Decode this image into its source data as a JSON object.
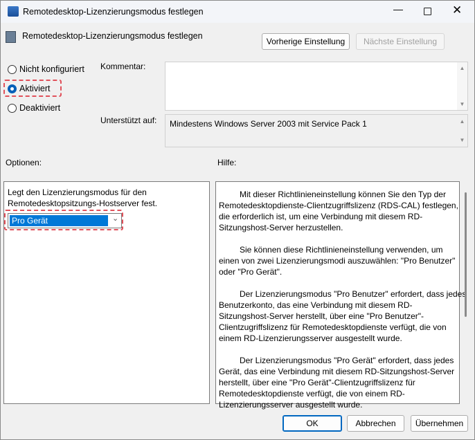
{
  "window": {
    "title": "Remotedesktop-Lizenzierungsmodus festlegen"
  },
  "header": {
    "title": "Remotedesktop-Lizenzierungsmodus festlegen",
    "prev_label": "Vorherige Einstellung",
    "next_label": "Nächste Einstellung"
  },
  "state": {
    "options": [
      "Nicht konfiguriert",
      "Aktiviert",
      "Deaktiviert"
    ],
    "selected": "Aktiviert"
  },
  "comment": {
    "label": "Kommentar:",
    "value": ""
  },
  "supported": {
    "label": "Unterstützt auf:",
    "value": "Mindestens Windows Server 2003 mit Service Pack 1"
  },
  "options_panel": {
    "label": "Optionen:",
    "description": [
      "Legt den Lizenzierungsmodus für den",
      "Remotedesktopsitzungs-Hostserver fest."
    ],
    "select_value": "Pro Gerät"
  },
  "help_panel": {
    "label": "Hilfe:",
    "paragraphs": [
      [
        "Mit dieser Richtlinieneinstellung können Sie den Typ der",
        "Remotedesktopdienste-Clientzugriffslizenz (RDS-CAL) festlegen,",
        "die erforderlich ist, um eine Verbindung mit diesem RD-",
        "Sitzungshost-Server herzustellen."
      ],
      [
        "Sie können diese Richtlinieneinstellung verwenden, um",
        "einen von zwei Lizenzierungsmodi auszuwählen: \"Pro Benutzer\"",
        "oder \"Pro Gerät\"."
      ],
      [
        "Der Lizenzierungsmodus \"Pro Benutzer\" erfordert, dass jedes",
        "Benutzerkonto, das eine Verbindung mit diesem RD-",
        "Sitzungshost-Server herstellt, über eine \"Pro Benutzer\"-",
        "Clientzugriffslizenz für Remotedesktopdienste verfügt, die von",
        "einem RD-Lizenzierungsserver ausgestellt wurde."
      ],
      [
        "Der Lizenzierungsmodus \"Pro Gerät\" erfordert, dass jedes",
        "Gerät, das eine Verbindung mit diesem RD-Sitzungshost-Server",
        "herstellt, über eine \"Pro Gerät\"-Clientzugriffslizenz für",
        "Remotedesktopdienste verfügt, die von einem RD-",
        "Lizenzierungsserver ausgestellt wurde."
      ]
    ]
  },
  "footer": {
    "ok": "OK",
    "cancel": "Abbrechen",
    "apply": "Übernehmen"
  }
}
